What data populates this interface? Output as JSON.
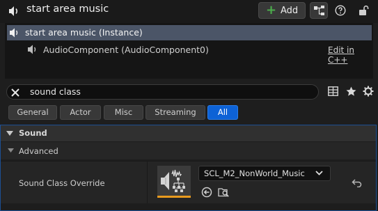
{
  "title_bar": {
    "title": "start area music",
    "add_label": "Add"
  },
  "components": {
    "instance_label": "start area music (Instance)",
    "audio_component_label": "AudioComponent (AudioComponent0)",
    "edit_link": "Edit in C++"
  },
  "search": {
    "value": "sound class"
  },
  "filter_tabs": {
    "general": "General",
    "actor": "Actor",
    "misc": "Misc",
    "streaming": "Streaming",
    "all": "All",
    "selected": "All"
  },
  "details": {
    "category": "Sound",
    "subcategory": "Advanced",
    "property_label": "Sound Class Override",
    "property_value": "SCL_M2_NonWorld_Music"
  },
  "colors": {
    "accent": "#0d62d6",
    "selection": "#4b5567",
    "add_plus": "#4cae4c",
    "thumbnail_underline": "#e89a1e"
  },
  "icons": [
    "speaker-icon",
    "plus-icon",
    "hierarchy-icon",
    "help-icon",
    "lock-icon",
    "clear-icon",
    "table-view-icon",
    "favorites-icon",
    "settings-icon",
    "chevron-down-icon",
    "use-selected-icon",
    "browse-icon",
    "reset-icon",
    "sound-class-icon"
  ]
}
